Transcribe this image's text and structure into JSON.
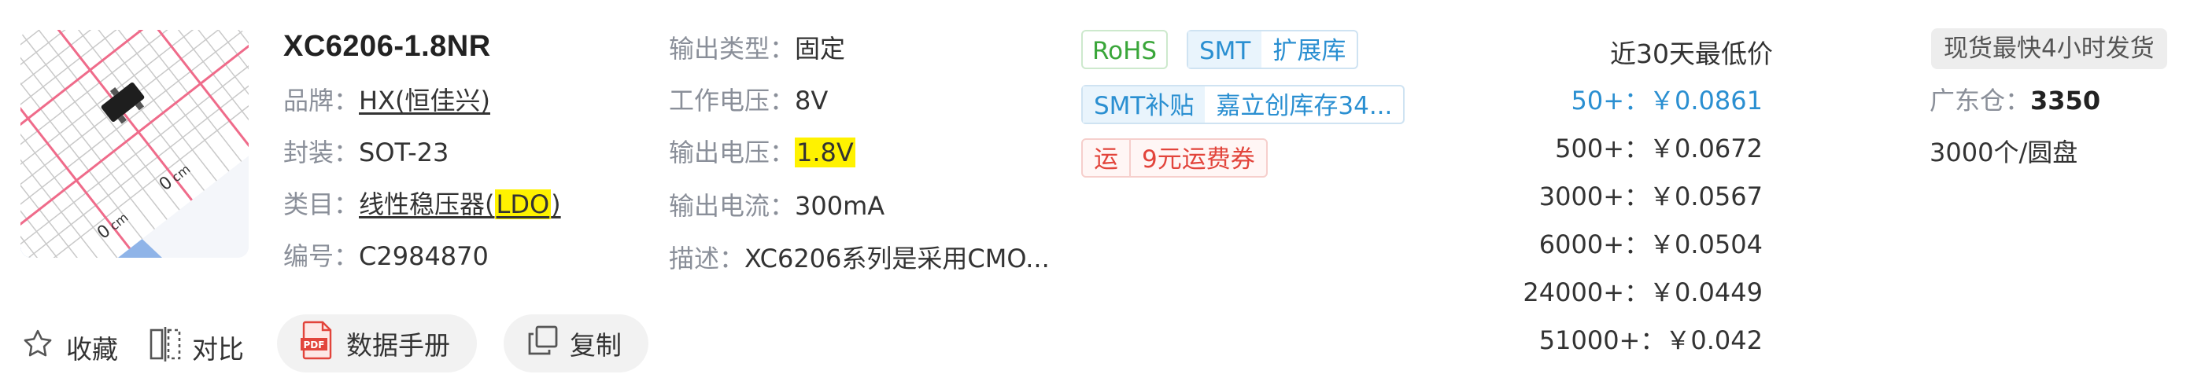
{
  "product": {
    "title": "XC6206-1.8NR",
    "brand_label": "品牌：",
    "brand_value": "HX(恒佳兴)",
    "package_label": "封装：",
    "package_value": "SOT-23",
    "category_label": "类目：",
    "category_text": "线性稳压器(",
    "category_highlight": "LDO",
    "category_close": ")",
    "code_label": "编号：",
    "code_value": "C2984870"
  },
  "specs": {
    "output_type_label": "输出类型：",
    "output_type_value": "固定",
    "working_voltage_label": "工作电压：",
    "working_voltage_value": "8V",
    "output_voltage_label": "输出电压：",
    "output_voltage_value": "1.8V",
    "output_current_label": "输出电流：",
    "output_current_value": "300mA",
    "desc_label": "描述：",
    "desc_value": "XC6206系列是采用CMO..."
  },
  "tags": {
    "rohs": "RoHS",
    "smt": "SMT",
    "expand_lib": "扩展库",
    "smt_subsidy": "SMT补贴",
    "jlc_stock": "嘉立创库存34...",
    "shipping_prefix": "运",
    "shipping_coupon": "9元运费券"
  },
  "pricing": {
    "heading": "近30天最低价",
    "tiers": [
      {
        "qty": "50+：",
        "price": "￥0.0861"
      },
      {
        "qty": "500+：",
        "price": "￥0.0672"
      },
      {
        "qty": "3000+：",
        "price": "￥0.0567"
      },
      {
        "qty": "6000+：",
        "price": "￥0.0504"
      },
      {
        "qty": "24000+：",
        "price": "￥0.0449"
      },
      {
        "qty": "51000+：",
        "price": "￥0.042"
      }
    ]
  },
  "stock": {
    "badge": "现货最快4小时发货",
    "warehouse_label": "广东仓：",
    "warehouse_qty": "3350",
    "packaging": "3000个/圆盘"
  },
  "actions": {
    "favorite": "收藏",
    "compare": "对比",
    "datasheet": "数据手册",
    "copy": "复制"
  },
  "colors": {
    "accent_blue": "#2a8fd1",
    "green": "#3aa63a",
    "red": "#e2443b",
    "highlight": "#fff200",
    "pdf_red": "#e2443b"
  }
}
